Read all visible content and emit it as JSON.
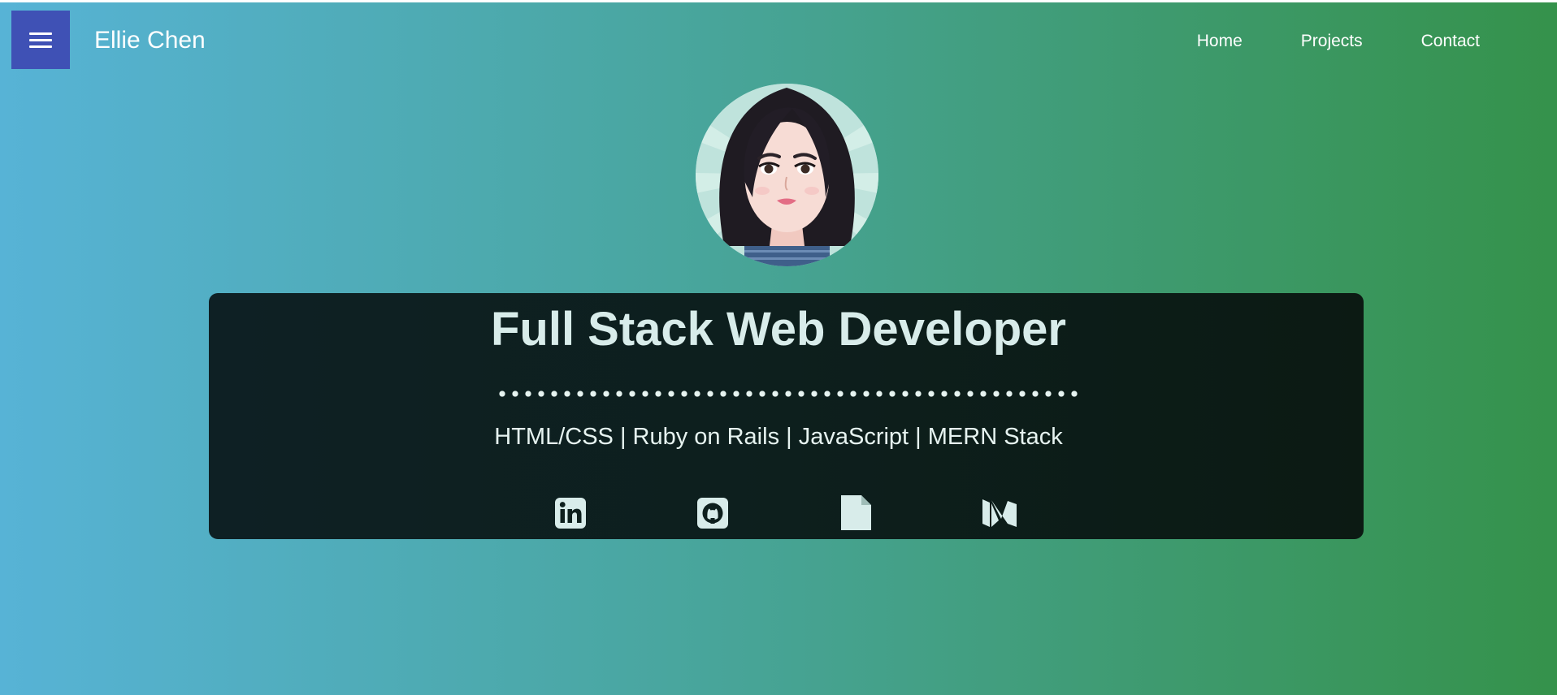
{
  "header": {
    "menu_icon": "hamburger-menu-icon",
    "brand": "Ellie Chen",
    "nav": [
      {
        "label": "Home"
      },
      {
        "label": "Projects"
      },
      {
        "label": "Contact"
      }
    ]
  },
  "hero": {
    "title": "Full Stack Web Developer",
    "skills": "HTML/CSS | Ruby on Rails | JavaScript | MERN Stack",
    "social": [
      {
        "icon": "linkedin-icon"
      },
      {
        "icon": "github-icon"
      },
      {
        "icon": "document-icon"
      },
      {
        "icon": "medium-icon"
      }
    ]
  },
  "colors": {
    "gradient_start": "#57b3d6",
    "gradient_end": "#35924b",
    "menu_button": "#3f51b5",
    "card_background": "#0d1f1d",
    "title_text": "#d8ecea"
  }
}
